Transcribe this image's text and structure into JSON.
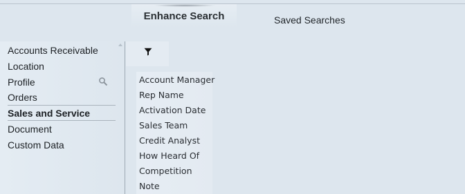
{
  "tabs": {
    "active_label": "Enhance Search",
    "inactive_label": "Saved Searches"
  },
  "sidebar": {
    "items": [
      {
        "label": "Accounts Receivable"
      },
      {
        "label": "Location"
      },
      {
        "label": "Profile"
      },
      {
        "label": "Orders"
      },
      {
        "label": "Sales and Service",
        "selected": true
      },
      {
        "label": "Document"
      },
      {
        "label": "Custom Data"
      }
    ],
    "profile_icon": "search-icon"
  },
  "filter": {
    "icon": "filter-icon"
  },
  "fields": [
    "Account Manager",
    "Rep Name",
    "Activation Date",
    "Sales Team",
    "Credit Analyst",
    "How Heard Of",
    "Competition",
    "Note"
  ]
}
